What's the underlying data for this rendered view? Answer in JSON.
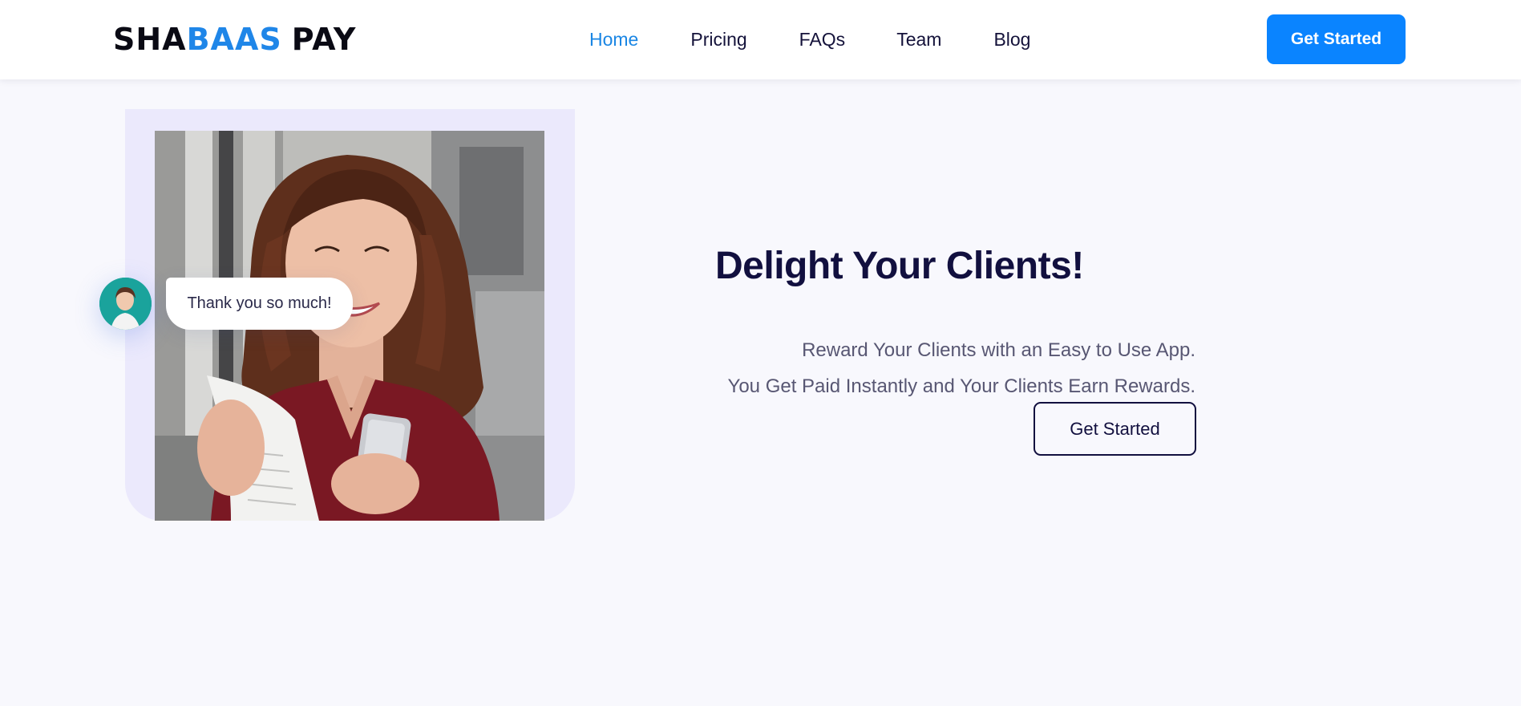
{
  "header": {
    "logo": {
      "part1": "SHA",
      "part2": "BAAS",
      "part3": "PAY"
    },
    "nav": [
      {
        "label": "Home",
        "active": true
      },
      {
        "label": "Pricing",
        "active": false
      },
      {
        "label": "FAQs",
        "active": false
      },
      {
        "label": "Team",
        "active": false
      },
      {
        "label": "Blog",
        "active": false
      }
    ],
    "cta_label": "Get Started"
  },
  "hero": {
    "chat_message": "Thank you so much!",
    "title": "Delight Your Clients!",
    "description_line1": "Reward Your Clients with an Easy to Use App.",
    "description_line2": "You Get Paid Instantly and Your Clients Earn Rewards.",
    "cta_label": "Get Started",
    "image_alt": "woman-smiling-with-phone-and-receipt"
  },
  "colors": {
    "brand_blue": "#0a84ff",
    "heading_navy": "#12103f",
    "page_bg": "#f8f8fd",
    "frame_lavender": "#ebe9fc",
    "avatar_teal": "#1aa39c"
  }
}
